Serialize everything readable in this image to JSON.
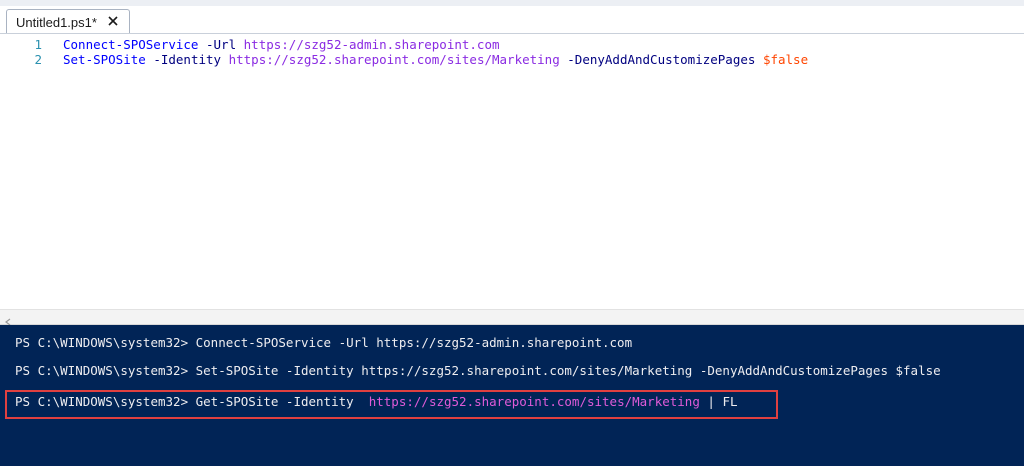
{
  "tab": {
    "title": "Untitled1.ps1*",
    "close_icon": "close-icon"
  },
  "editor": {
    "lines": [
      {
        "number": "1",
        "cmdlet": "Connect-SPOService",
        "param1": "-Url",
        "value1": "https://szg52-admin.sharepoint.com"
      },
      {
        "number": "2",
        "cmdlet": "Set-SPOSite",
        "param1": "-Identity",
        "value1": "https://szg52.sharepoint.com/sites/Marketing",
        "param2": "-DenyAddAndCustomizePages",
        "value2": "$false"
      }
    ]
  },
  "console": {
    "prompt": "PS C:\\WINDOWS\\system32>",
    "lines": [
      {
        "command": "Connect-SPOService -Url https://szg52-admin.sharepoint.com"
      },
      {
        "command": "Set-SPOSite -Identity https://szg52.sharepoint.com/sites/Marketing -DenyAddAndCustomizePages $false"
      },
      {
        "command": "Get-SPOSite -Identity",
        "url": "https://szg52.sharepoint.com/sites/Marketing",
        "suffix": "| FL"
      }
    ]
  },
  "colors": {
    "console_bg": "#012456",
    "highlight": "#e04040",
    "cmdlet": "#0000ff",
    "parameter": "#000080",
    "string": "#8a2be2",
    "variable": "#ff4500"
  }
}
